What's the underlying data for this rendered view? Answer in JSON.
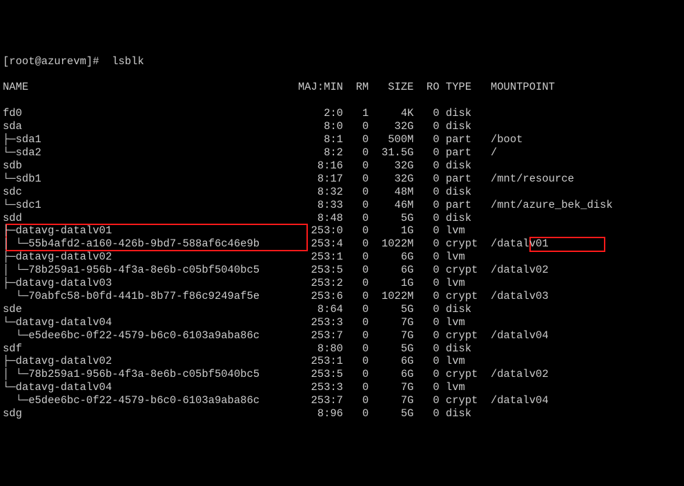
{
  "prompt": "[root@azurevm]#  lsblk",
  "header": {
    "name": "NAME",
    "majmin": "MAJ:MIN",
    "rm": "RM",
    "size": "SIZE",
    "ro": "RO",
    "type": "TYPE",
    "mountpoint": "MOUNTPOINT"
  },
  "rows": [
    {
      "name": "fd0",
      "majmin": "2:0",
      "rm": "1",
      "size": "4K",
      "ro": "0",
      "type": "disk",
      "mountpoint": ""
    },
    {
      "name": "sda",
      "majmin": "8:0",
      "rm": "0",
      "size": "32G",
      "ro": "0",
      "type": "disk",
      "mountpoint": ""
    },
    {
      "name": "├─sda1",
      "majmin": "8:1",
      "rm": "0",
      "size": "500M",
      "ro": "0",
      "type": "part",
      "mountpoint": "/boot"
    },
    {
      "name": "└─sda2",
      "majmin": "8:2",
      "rm": "0",
      "size": "31.5G",
      "ro": "0",
      "type": "part",
      "mountpoint": "/"
    },
    {
      "name": "sdb",
      "majmin": "8:16",
      "rm": "0",
      "size": "32G",
      "ro": "0",
      "type": "disk",
      "mountpoint": ""
    },
    {
      "name": "└─sdb1",
      "majmin": "8:17",
      "rm": "0",
      "size": "32G",
      "ro": "0",
      "type": "part",
      "mountpoint": "/mnt/resource"
    },
    {
      "name": "sdc",
      "majmin": "8:32",
      "rm": "0",
      "size": "48M",
      "ro": "0",
      "type": "disk",
      "mountpoint": ""
    },
    {
      "name": "└─sdc1",
      "majmin": "8:33",
      "rm": "0",
      "size": "46M",
      "ro": "0",
      "type": "part",
      "mountpoint": "/mnt/azure_bek_disk"
    },
    {
      "name": "sdd",
      "majmin": "8:48",
      "rm": "0",
      "size": "5G",
      "ro": "0",
      "type": "disk",
      "mountpoint": ""
    },
    {
      "name": "├─datavg-datalv01",
      "majmin": "253:0",
      "rm": "0",
      "size": "1G",
      "ro": "0",
      "type": "lvm",
      "mountpoint": ""
    },
    {
      "name": "│ └─55b4afd2-a160-426b-9bd7-588af6c46e9b",
      "majmin": "253:4",
      "rm": "0",
      "size": "1022M",
      "ro": "0",
      "type": "crypt",
      "mountpoint": "/datalv01"
    },
    {
      "name": "├─datavg-datalv02",
      "majmin": "253:1",
      "rm": "0",
      "size": "6G",
      "ro": "0",
      "type": "lvm",
      "mountpoint": ""
    },
    {
      "name": "│ └─78b259a1-956b-4f3a-8e6b-c05bf5040bc5",
      "majmin": "253:5",
      "rm": "0",
      "size": "6G",
      "ro": "0",
      "type": "crypt",
      "mountpoint": "/datalv02"
    },
    {
      "name": "├─datavg-datalv03",
      "majmin": "253:2",
      "rm": "0",
      "size": "1G",
      "ro": "0",
      "type": "lvm",
      "mountpoint": ""
    },
    {
      "name": "  └─70abfc58-b0fd-441b-8b77-f86c9249af5e",
      "majmin": "253:6",
      "rm": "0",
      "size": "1022M",
      "ro": "0",
      "type": "crypt",
      "mountpoint": "/datalv03"
    },
    {
      "name": "sde",
      "majmin": "8:64",
      "rm": "0",
      "size": "5G",
      "ro": "0",
      "type": "disk",
      "mountpoint": ""
    },
    {
      "name": "└─datavg-datalv04",
      "majmin": "253:3",
      "rm": "0",
      "size": "7G",
      "ro": "0",
      "type": "lvm",
      "mountpoint": ""
    },
    {
      "name": "  └─e5dee6bc-0f22-4579-b6c0-6103a9aba86c",
      "majmin": "253:7",
      "rm": "0",
      "size": "7G",
      "ro": "0",
      "type": "crypt",
      "mountpoint": "/datalv04"
    },
    {
      "name": "sdf",
      "majmin": "8:80",
      "rm": "0",
      "size": "5G",
      "ro": "0",
      "type": "disk",
      "mountpoint": ""
    },
    {
      "name": "├─datavg-datalv02",
      "majmin": "253:1",
      "rm": "0",
      "size": "6G",
      "ro": "0",
      "type": "lvm",
      "mountpoint": ""
    },
    {
      "name": "│ └─78b259a1-956b-4f3a-8e6b-c05bf5040bc5",
      "majmin": "253:5",
      "rm": "0",
      "size": "6G",
      "ro": "0",
      "type": "crypt",
      "mountpoint": "/datalv02"
    },
    {
      "name": "└─datavg-datalv04",
      "majmin": "253:3",
      "rm": "0",
      "size": "7G",
      "ro": "0",
      "type": "lvm",
      "mountpoint": ""
    },
    {
      "name": "  └─e5dee6bc-0f22-4579-b6c0-6103a9aba86c",
      "majmin": "253:7",
      "rm": "0",
      "size": "7G",
      "ro": "0",
      "type": "crypt",
      "mountpoint": "/datalv04"
    },
    {
      "name": "sdg",
      "majmin": "8:96",
      "rm": "0",
      "size": "5G",
      "ro": "0",
      "type": "disk",
      "mountpoint": ""
    }
  ],
  "cols": {
    "name_w": 46,
    "majmin_w": 7,
    "rm_w": 3,
    "size_w": 6,
    "ro_w": 3,
    "type_w": 5
  },
  "highlight_rows": [
    9,
    10
  ]
}
